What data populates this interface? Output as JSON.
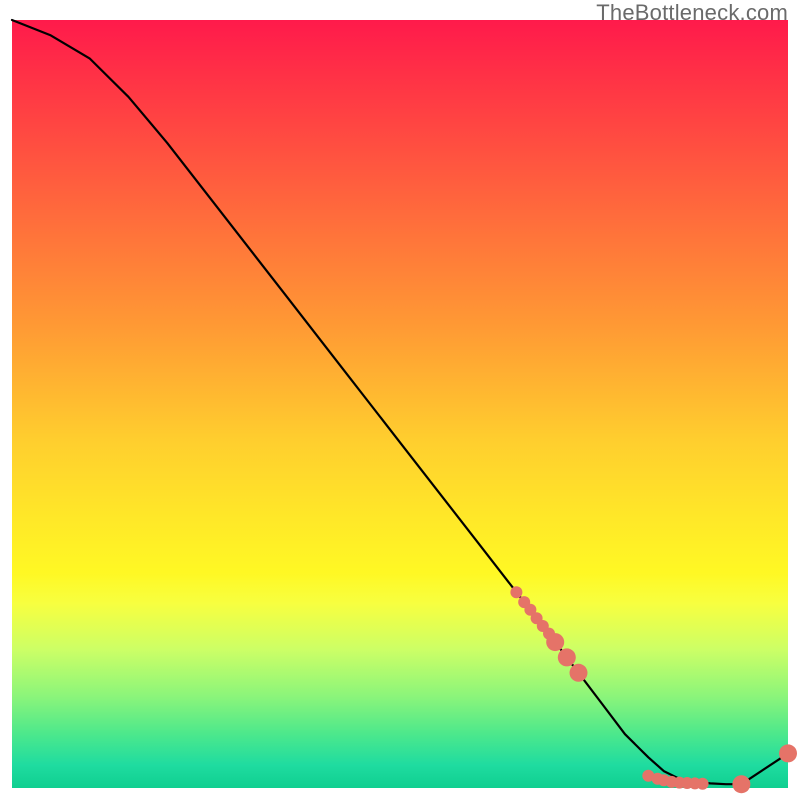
{
  "watermark": "TheBottleneck.com",
  "chart_data": {
    "type": "line",
    "title": "",
    "xlabel": "",
    "ylabel": "",
    "xlim": [
      0,
      100
    ],
    "ylim": [
      0,
      100
    ],
    "series": [
      {
        "name": "bottleneck-curve",
        "x": [
          0,
          5,
          10,
          15,
          20,
          25,
          30,
          35,
          40,
          45,
          50,
          55,
          60,
          65,
          70,
          73,
          76,
          79,
          82,
          84,
          86,
          88,
          90,
          92,
          94,
          100
        ],
        "y": [
          100,
          98,
          95,
          90,
          84,
          77.5,
          71,
          64.5,
          58,
          51.5,
          45,
          38.5,
          32,
          25.5,
          19,
          15,
          11,
          7,
          4,
          2.2,
          1.2,
          0.8,
          0.6,
          0.5,
          0.5,
          4.5
        ]
      }
    ],
    "markers": {
      "name": "highlighted-points",
      "color": "#e57368",
      "radius_small": 6,
      "radius_large": 9,
      "points": [
        {
          "x": 65.0,
          "y": 25.5,
          "r": 6
        },
        {
          "x": 66.0,
          "y": 24.2,
          "r": 6
        },
        {
          "x": 66.8,
          "y": 23.2,
          "r": 6
        },
        {
          "x": 67.6,
          "y": 22.1,
          "r": 6
        },
        {
          "x": 68.4,
          "y": 21.1,
          "r": 6
        },
        {
          "x": 69.2,
          "y": 20.1,
          "r": 6
        },
        {
          "x": 70.0,
          "y": 19.0,
          "r": 9
        },
        {
          "x": 71.5,
          "y": 17.0,
          "r": 9
        },
        {
          "x": 73.0,
          "y": 15.0,
          "r": 9
        },
        {
          "x": 82.0,
          "y": 1.6,
          "r": 6
        },
        {
          "x": 83.2,
          "y": 1.2,
          "r": 6
        },
        {
          "x": 84.0,
          "y": 1.0,
          "r": 6
        },
        {
          "x": 85.0,
          "y": 0.8,
          "r": 6
        },
        {
          "x": 86.0,
          "y": 0.7,
          "r": 6
        },
        {
          "x": 87.0,
          "y": 0.65,
          "r": 6
        },
        {
          "x": 88.0,
          "y": 0.6,
          "r": 6
        },
        {
          "x": 89.0,
          "y": 0.55,
          "r": 6
        },
        {
          "x": 94.0,
          "y": 0.5,
          "r": 9
        },
        {
          "x": 100.0,
          "y": 4.5,
          "r": 9
        }
      ]
    }
  }
}
